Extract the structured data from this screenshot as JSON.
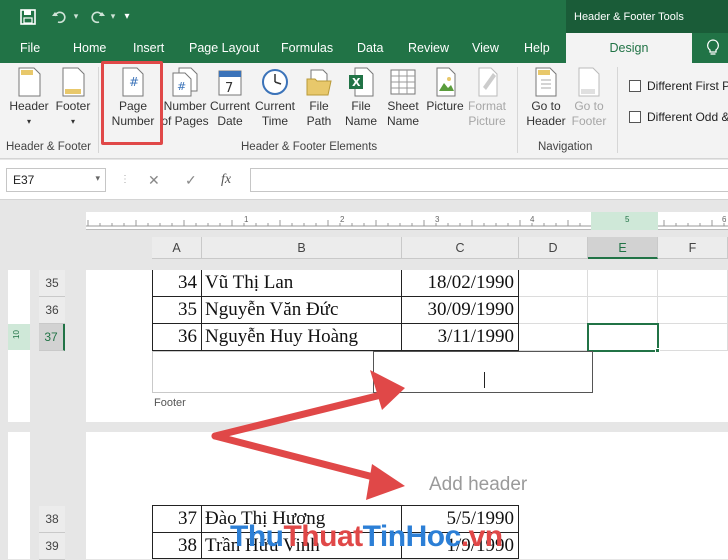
{
  "titlebar": {
    "context_title": "Header & Footer Tools"
  },
  "menu": {
    "tabs": [
      "File",
      "Home",
      "Insert",
      "Page Layout",
      "Formulas",
      "Data",
      "Review",
      "View",
      "Help"
    ],
    "active_tab": "Design",
    "lightbulb": "tell-me-icon"
  },
  "ribbon": {
    "hf_group": {
      "label": "Header & Footer",
      "header": "Header",
      "footer": "Footer"
    },
    "elements_group": {
      "label": "Header & Footer Elements",
      "page_number": [
        "Page",
        "Number"
      ],
      "number_of_pages": [
        "Number",
        "of Pages"
      ],
      "current_date": [
        "Current",
        "Date"
      ],
      "current_time": [
        "Current",
        "Time"
      ],
      "file_path": [
        "File",
        "Path"
      ],
      "file_name": [
        "File",
        "Name"
      ],
      "sheet_name": [
        "Sheet",
        "Name"
      ],
      "picture": "Picture",
      "format_picture": [
        "Format",
        "Picture"
      ]
    },
    "nav_group": {
      "label": "Navigation",
      "go_header": [
        "Go to",
        "Header"
      ],
      "go_footer": [
        "Go to",
        "Footer"
      ]
    },
    "options": {
      "first_page": "Different First P",
      "odd_even": "Different Odd &"
    }
  },
  "formula_bar": {
    "name_box": "E37",
    "cancel": "✕",
    "enter": "✓",
    "fx": "fx",
    "value": ""
  },
  "ruler_marks": [
    "1",
    "2",
    "3",
    "4",
    "5",
    "6"
  ],
  "columns": [
    "A",
    "B",
    "C",
    "D",
    "E",
    "F"
  ],
  "rows_page1": [
    {
      "row": "35",
      "a": "34",
      "b": "Vũ Thị Lan",
      "c": "18/02/1990"
    },
    {
      "row": "36",
      "a": "35",
      "b": "Nguyễn Văn Đức",
      "c": "30/09/1990"
    },
    {
      "row": "37",
      "a": "36",
      "b": "Nguyễn Huy Hoàng",
      "c": "3/11/1990"
    }
  ],
  "footer_label": "Footer",
  "add_header": "Add header",
  "rows_page2": [
    {
      "row": "38",
      "a": "37",
      "b": "Đào Thị Hương",
      "c": "5/5/1990"
    },
    {
      "row": "39",
      "a": "38",
      "b": "Trần Hữu Vinh",
      "c": "1/9/1990"
    }
  ],
  "vruler_label": "10",
  "watermark": {
    "part1": "Thu",
    "part2": "Thuat",
    "part3": "TinHoc",
    "part4": ".vn"
  },
  "colors": {
    "accent": "#217346",
    "highlight": "#e04848"
  }
}
